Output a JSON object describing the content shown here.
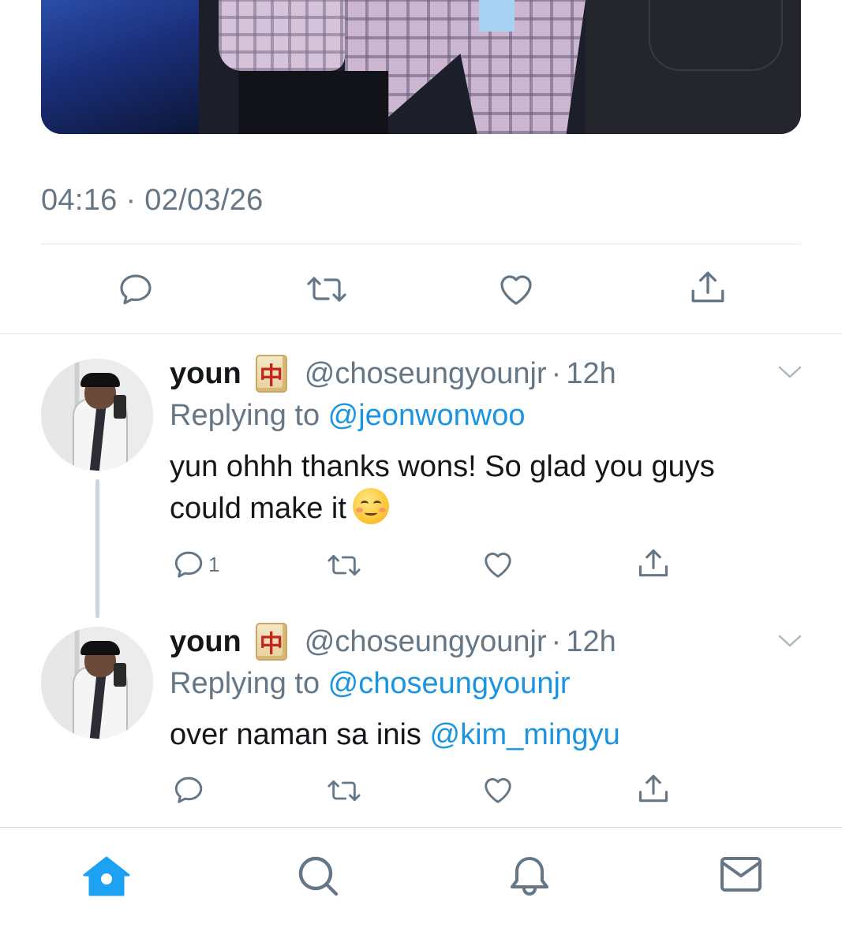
{
  "media": {
    "icon": "photo"
  },
  "main_tweet": {
    "timestamp": "04:16 · 02/03/26",
    "actions": {
      "reply_icon": "reply-icon",
      "retweet_icon": "retweet-icon",
      "like_icon": "heart-icon",
      "share_icon": "share-icon"
    }
  },
  "replies": [
    {
      "display_name": "youn",
      "badge": "🀄",
      "handle": "@choseungyounjr",
      "separator": "·",
      "time": "12h",
      "replying_label": "Replying to ",
      "replying_to": "@jeonwonwoo",
      "text": "yun ohhh thanks wons! So glad you guys could make it",
      "emoji": "☺️",
      "reply_count": "1"
    },
    {
      "display_name": "youn",
      "badge": "🀄",
      "handle": "@choseungyounjr",
      "separator": "·",
      "time": "12h",
      "replying_label": "Replying to ",
      "replying_to": "@choseungyounjr",
      "text": "over naman sa inis ",
      "mention": "@kim_mingyu",
      "reply_count": ""
    }
  ],
  "tabbar": {
    "tabs": [
      {
        "name": "home",
        "icon": "home-icon",
        "active": true
      },
      {
        "name": "search",
        "icon": "search-icon",
        "active": false
      },
      {
        "name": "notifications",
        "icon": "bell-icon",
        "active": false
      },
      {
        "name": "messages",
        "icon": "mail-icon",
        "active": false
      }
    ],
    "active_color": "#1da1f2",
    "inactive_color": "#657786"
  }
}
